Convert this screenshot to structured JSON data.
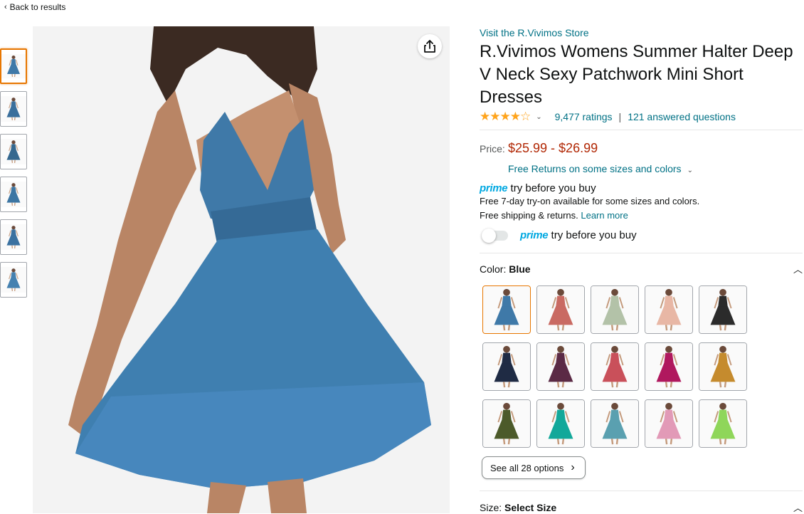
{
  "nav": {
    "back_label": "Back to results"
  },
  "product": {
    "store_link": "Visit the R.Vivimos Store",
    "title": "R.Vivimos Womens Summer Halter Deep V Neck Sexy Patchwork Mini Short Dresses",
    "stars": "★★★★☆",
    "rating_out_of_5": 4.3,
    "ratings_link": "9,477 ratings",
    "separator": "|",
    "questions_link": "121 answered questions",
    "price_label": "Price:",
    "price": "$25.99 - $26.99",
    "returns_link": "Free Returns on some sizes and colors"
  },
  "prime": {
    "logo_text": "prime",
    "head_text": "try before you buy",
    "line1": "Free 7-day try-on available for some sizes and colors.",
    "line2": "Free shipping & returns.",
    "learn_more": "Learn more",
    "toggle_logo": "prime",
    "toggle_text": "try before you buy",
    "toggle_on": false
  },
  "color": {
    "label": "Color:",
    "selected": "Blue",
    "see_all": "See all 28 options"
  },
  "size": {
    "label": "Size:",
    "selected": "Select Size"
  },
  "colors": {
    "accent": "#e77600",
    "link": "#007185",
    "price": "#b12704",
    "prime": "#00a8e1",
    "star": "#ffa41c",
    "swatch_dresses": [
      "#3f79a8",
      "#c96a62",
      "#b3c2a8",
      "#e8b7a5",
      "#2b2b2b",
      "#1f2b44",
      "#5b2a45",
      "#c9505a",
      "#b0185e",
      "#c58b2e",
      "#4c5a2a",
      "#12a89a",
      "#5aa0b0",
      "#e29ab7",
      "#8fd65a"
    ],
    "thumb_dresses": [
      "#3f79a8",
      "#3a6f9c",
      "#35688f",
      "#3d76a3",
      "#3a71a0",
      "#4581b0"
    ]
  }
}
